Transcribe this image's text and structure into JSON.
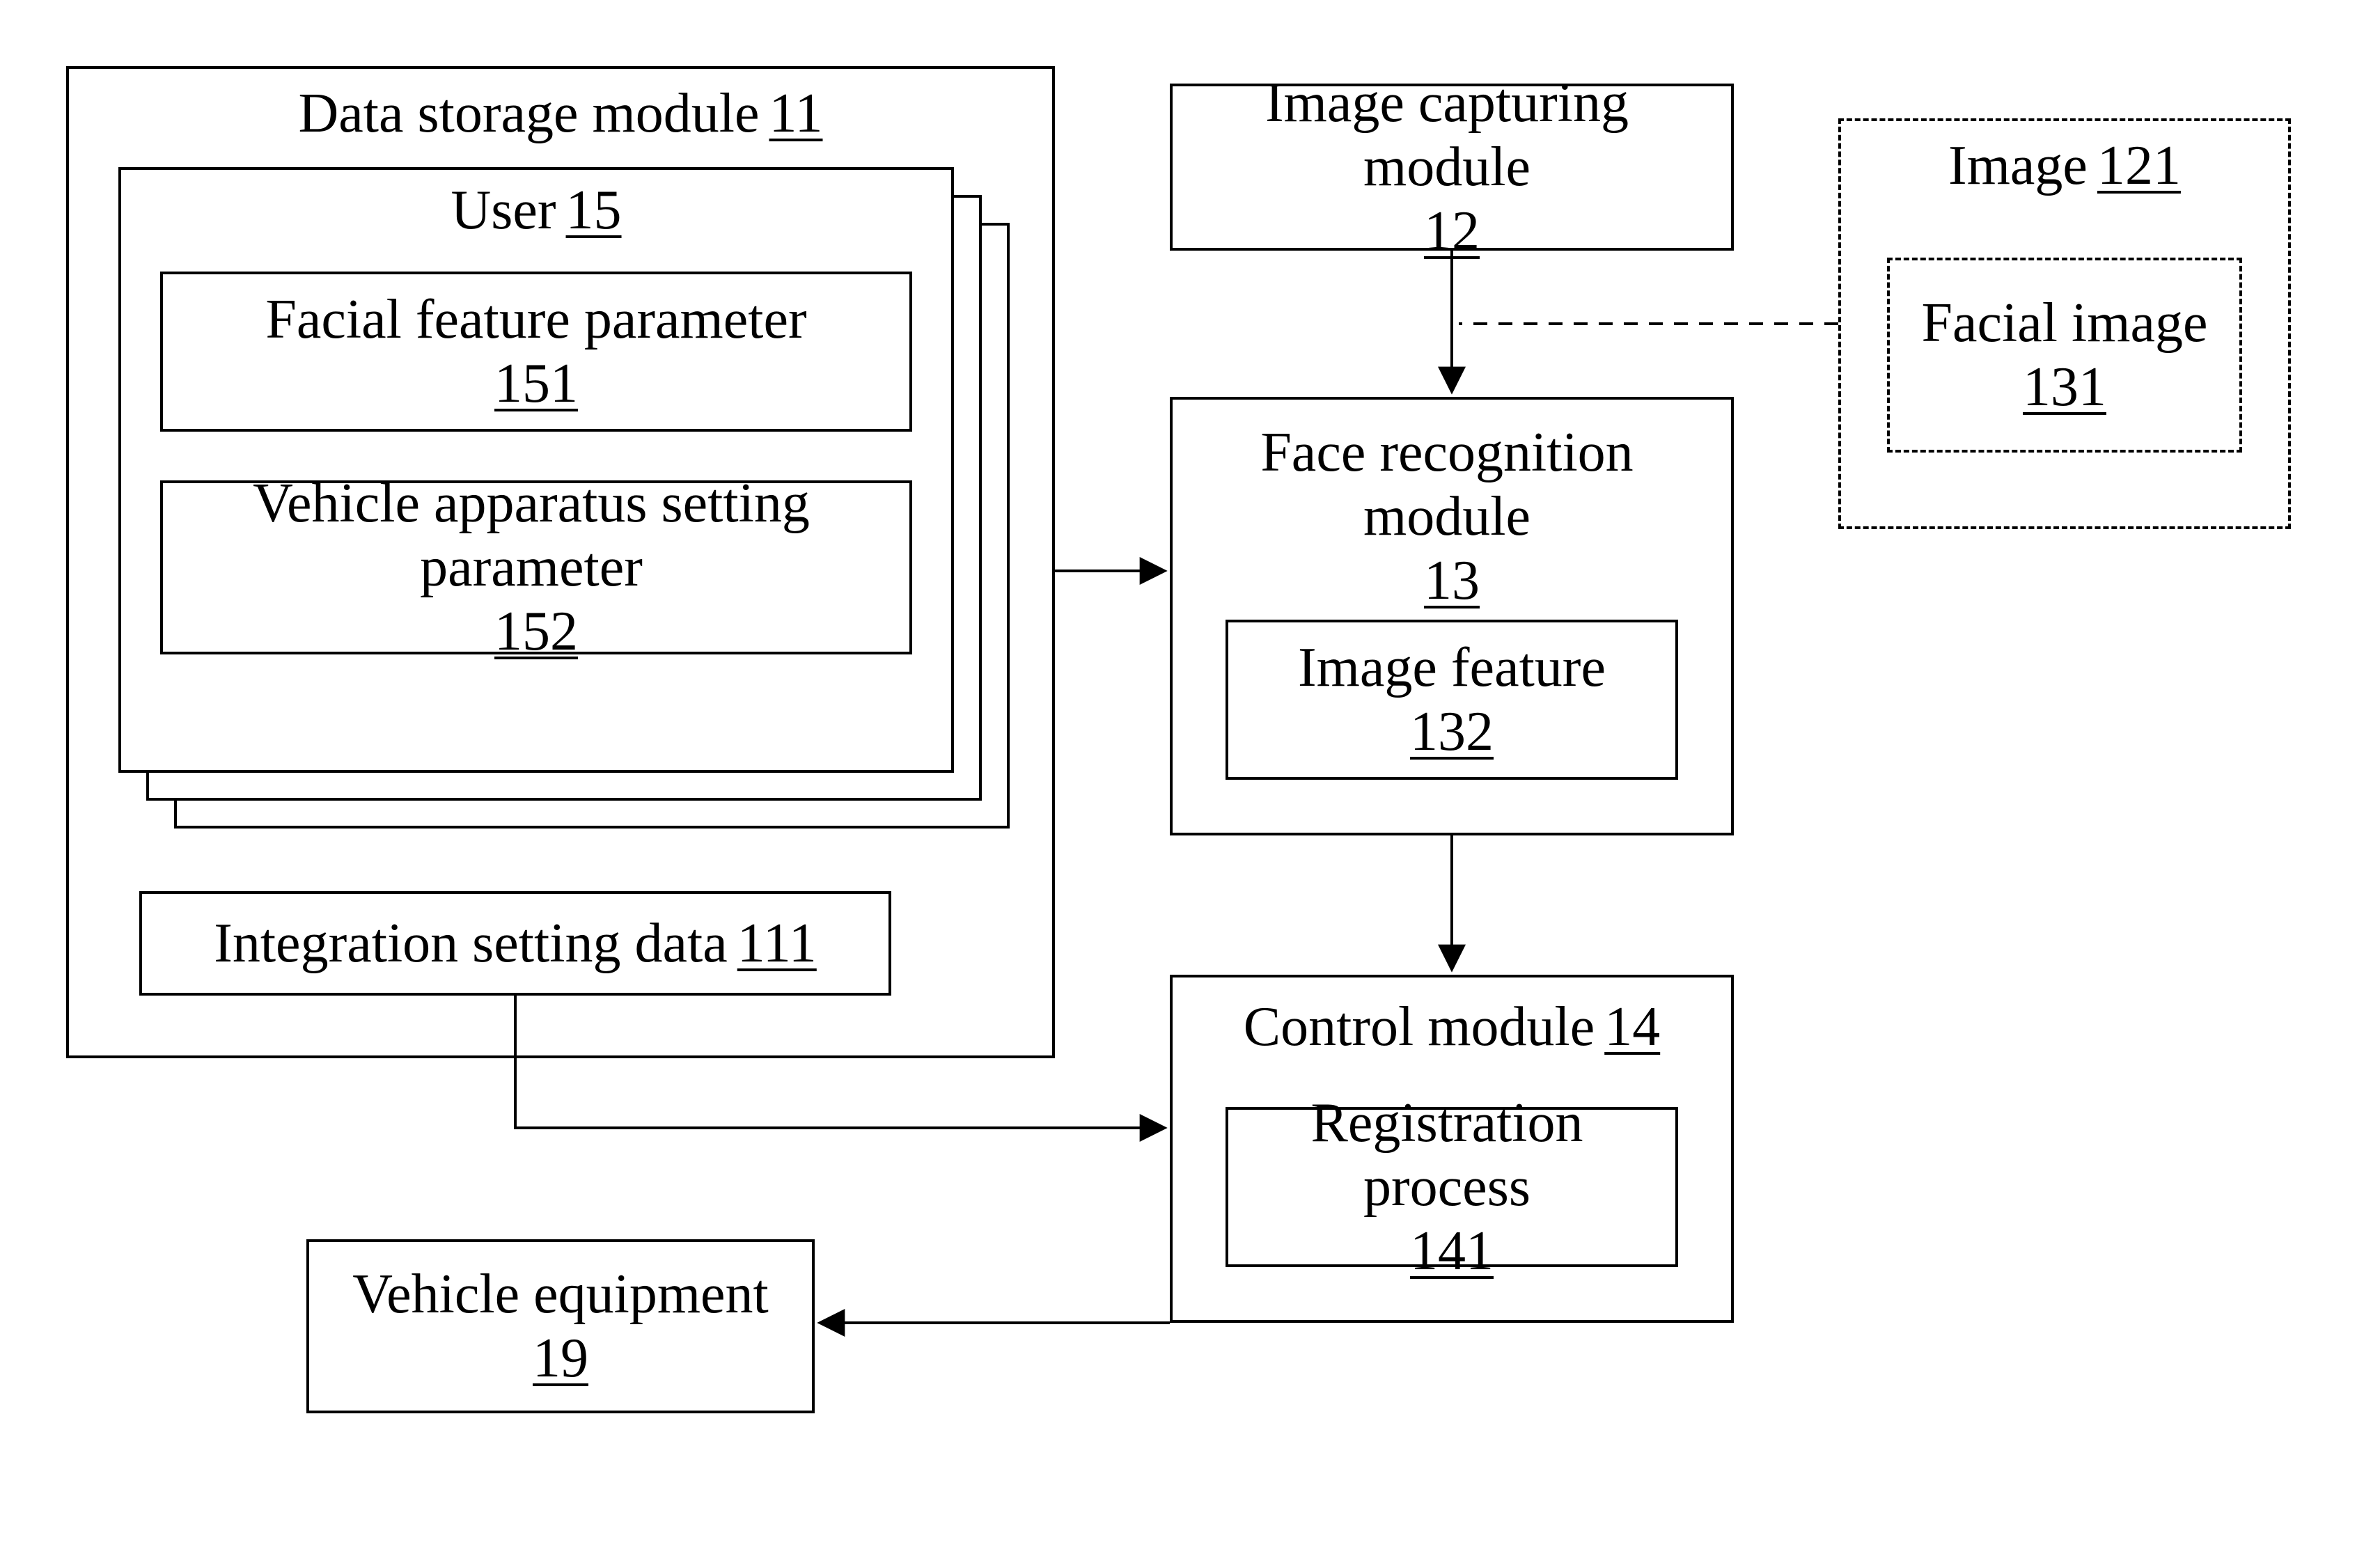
{
  "dataStorage": {
    "label": "Data storage module",
    "num": "11"
  },
  "user": {
    "label": "User",
    "num": "15"
  },
  "facialFeatureParam": {
    "label": "Facial feature parameter",
    "num": "151"
  },
  "vehicleSettingParam": {
    "label": "Vehicle apparatus setting parameter",
    "num": "152"
  },
  "integrationSetting": {
    "label": "Integration setting data",
    "num": "111"
  },
  "imageCapturing": {
    "label": "Image capturing module",
    "num": "12"
  },
  "faceRecognition": {
    "label": "Face recognition module",
    "num": "13"
  },
  "imageFeature": {
    "label": "Image feature",
    "num": "132"
  },
  "control": {
    "label": "Control module",
    "num": "14"
  },
  "registrationProcess": {
    "label": "Registration process",
    "num": "141"
  },
  "image": {
    "label": "Image",
    "num": "121"
  },
  "facialImage": {
    "label": "Facial image",
    "num": "131"
  },
  "vehicleEquipment": {
    "label": "Vehicle equipment",
    "num": "19"
  }
}
